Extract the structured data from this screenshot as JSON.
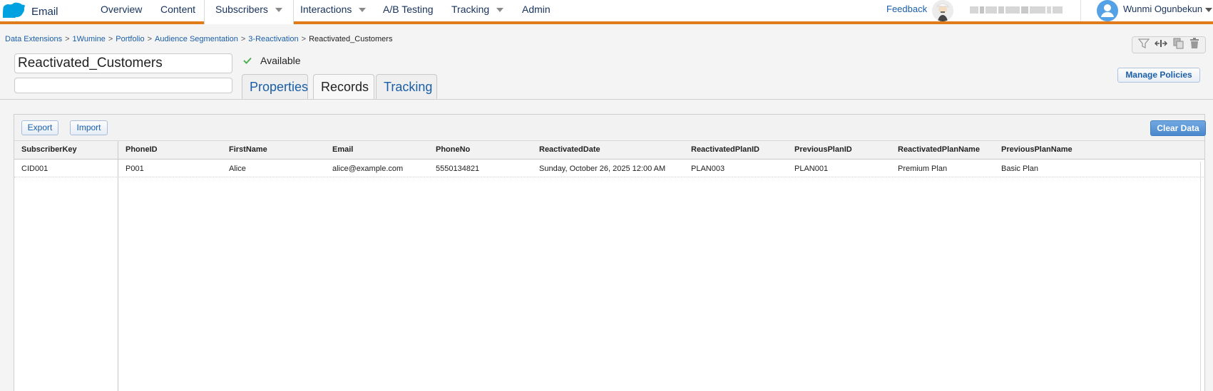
{
  "app": {
    "name": "Email",
    "nav": [
      "Overview",
      "Content",
      "Subscribers",
      "Interactions",
      "A/B Testing",
      "Tracking",
      "Admin"
    ],
    "feedback": "Feedback",
    "user_name": "Wunmi Ogunbekun",
    "accent_color": "#e07b1a"
  },
  "breadcrumb": [
    "Data Extensions",
    "1Wumine",
    "Portfolio",
    "Audience Segmentation",
    "3-Reactivation",
    "Reactivated_Customers"
  ],
  "header": {
    "name_value": "Reactivated_Customers",
    "status": "Available",
    "manage_policies": "Manage Policies"
  },
  "tabs": [
    "Properties",
    "Records",
    "Tracking"
  ],
  "records": {
    "export": "Export",
    "import": "Import",
    "clear_data": "Clear Data",
    "columns": [
      "SubscriberKey",
      "PhoneID",
      "FirstName",
      "Email",
      "PhoneNo",
      "ReactivatedDate",
      "ReactivatedPlanID",
      "PreviousPlanID",
      "ReactivatedPlanName",
      "PreviousPlanName"
    ],
    "rows": [
      [
        "CID001",
        "P001",
        "Alice",
        "alice@example.com",
        "5550134821",
        "Sunday, October 26, 2025 12:00 AM",
        "PLAN003",
        "PLAN001",
        "Premium Plan",
        "Basic Plan"
      ]
    ]
  }
}
